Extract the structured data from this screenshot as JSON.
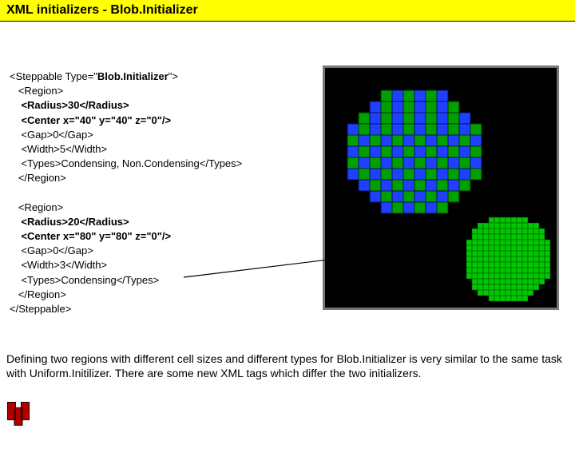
{
  "title": "XML initializers - Blob.Initializer",
  "xml": {
    "line1": "<Steppable Type=\"",
    "line1b": "Blob.Initializer",
    "line1c": "\">",
    "line2": "   <Region>",
    "line3a": "    <Radius>",
    "line3b": "30",
    "line3c": "</Radius>",
    "line4": "    <Center x=\"40\" y=\"40\" z=\"0\"/>",
    "line5": "    <Gap>0</Gap>",
    "line6": "    <Width>5</Width>",
    "line7": "    <Types>Condensing, Non.Condensing</Types>",
    "line8": "   </Region>",
    "blank1": "",
    "line9": "   <Region>",
    "line10a": "    <Radius>",
    "line10b": "20",
    "line10c": "</Radius>",
    "line11": "    <Center x=\"80\" y=\"80\" z=\"0\"/>",
    "line12": "    <Gap>0</Gap>",
    "line13": "    <Width>3</Width>",
    "line14": "    <Types>Condensing</Types>",
    "line15": "   </Region>",
    "line16": "</Steppable>"
  },
  "footer": "Defining two regions with different cell sizes and different types for Blob.Initializer is very similar to the same task with Uniform.Initilizer. There are some new XML tags which differ the two initializers.",
  "colors": {
    "green": "#00a000",
    "blue": "#2040ff",
    "black": "#000000"
  }
}
